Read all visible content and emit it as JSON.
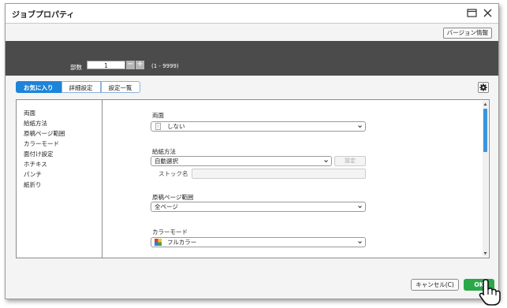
{
  "window": {
    "title": "ジョブプロパティ"
  },
  "header": {
    "version_button": "バージョン情報"
  },
  "copies": {
    "label": "部数",
    "value": "1",
    "range": "(1 - 9999)",
    "minus": "−",
    "plus": "+"
  },
  "tabs": [
    {
      "label": "お気に入り",
      "active": true
    },
    {
      "label": "詳細設定",
      "active": false
    },
    {
      "label": "設定一覧",
      "active": false
    }
  ],
  "sidebar": {
    "items": [
      "両面",
      "給紙方法",
      "原稿ページ範囲",
      "カラーモード",
      "面付け設定",
      "ホチキス",
      "パンチ",
      "紙折り"
    ]
  },
  "settings": {
    "duplex": {
      "label": "両面",
      "value": "しない",
      "icon": "duplex-icon"
    },
    "paper_source": {
      "label": "給紙方法",
      "value": "自動選択",
      "setting_button": "設定",
      "stock_label": "ストック名",
      "stock_value": ""
    },
    "page_range": {
      "label": "原稿ページ範囲",
      "value": "全ページ"
    },
    "color_mode": {
      "label": "カラーモード",
      "value": "フルカラー",
      "icon": "full-color-icon"
    }
  },
  "footer": {
    "cancel": "キャンセル(C)",
    "ok": "OK"
  },
  "colors": {
    "accent": "#1d84d8",
    "ok_green": "#2aa84a",
    "dark_band": "#4b4b4b"
  }
}
